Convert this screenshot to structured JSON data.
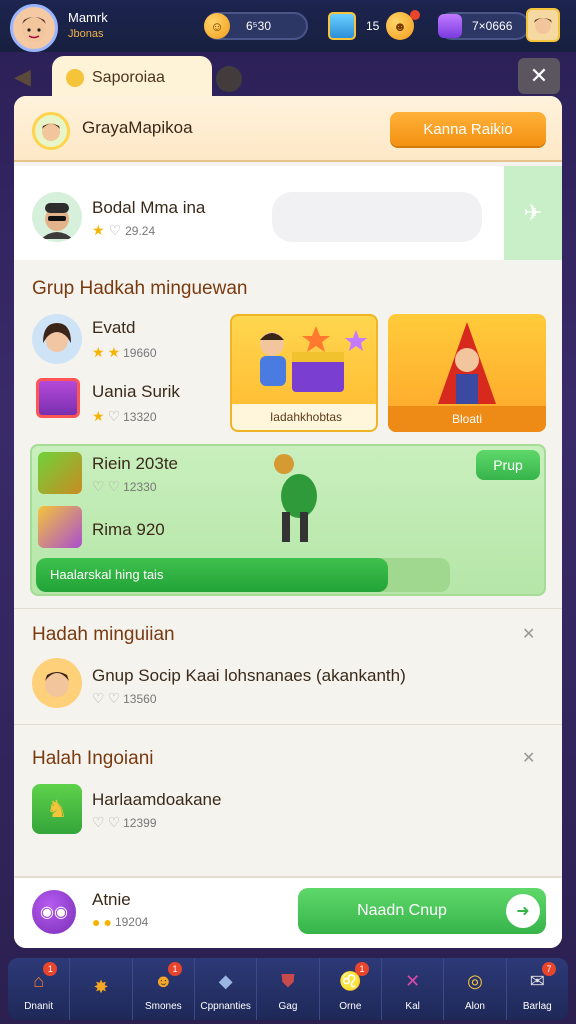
{
  "header": {
    "user_name": "Mamrk",
    "user_sub": "Jbonas",
    "coins_value": "6⁵30",
    "chest_value": "15",
    "gems_value": "7×0666"
  },
  "back_tab": {
    "label": "Saporoiaa"
  },
  "group_header": {
    "name": "GrayaMapikoa",
    "button_label": "Kanna Raikio"
  },
  "profile_row": {
    "name": "Bodal Mma ina",
    "score": "29.24"
  },
  "section1": {
    "title": "Grup Hadkah minguewan",
    "items": [
      {
        "name": "Evatd",
        "score": "19660"
      },
      {
        "name": "Uania Surik",
        "score": "13320"
      }
    ],
    "cards": [
      {
        "label": "Iadahkhobtas"
      },
      {
        "label": "Bloati"
      }
    ]
  },
  "green_card": {
    "items": [
      {
        "name": "Riein 203te",
        "score": "12330"
      },
      {
        "name": "Rima 920"
      }
    ],
    "button_label": "Prup",
    "progress_label": "Haalarskal hing tais",
    "progress": 0.85
  },
  "section2": {
    "title": "Hadah minguiian",
    "item": {
      "name": "Gnup Socip Kaai lohsnanaes (akankanth)",
      "score": "13560"
    }
  },
  "section3": {
    "title": "Halah Ingoiani",
    "item": {
      "name": "Harlaamdoakane",
      "score": "12399"
    }
  },
  "footer": {
    "name": "Atnie",
    "score": "19204",
    "button_label": "Naadn Cnup"
  },
  "nav": [
    {
      "label": "Dnanit",
      "icon": "home-icon",
      "badge": "1"
    },
    {
      "label": "",
      "icon": "star-badge-icon",
      "badge": ""
    },
    {
      "label": "Smones",
      "icon": "smiley-icon",
      "badge": "1"
    },
    {
      "label": "Cppnanties",
      "icon": "cat-icon",
      "badge": ""
    },
    {
      "label": "Gag",
      "icon": "shield-icon",
      "badge": ""
    },
    {
      "label": "Orne",
      "icon": "lion-icon",
      "badge": "1"
    },
    {
      "label": "Kal",
      "icon": "sword-icon",
      "badge": ""
    },
    {
      "label": "Alon",
      "icon": "ring-icon",
      "badge": ""
    },
    {
      "label": "Barlag",
      "icon": "bag-icon",
      "badge": "7"
    }
  ]
}
